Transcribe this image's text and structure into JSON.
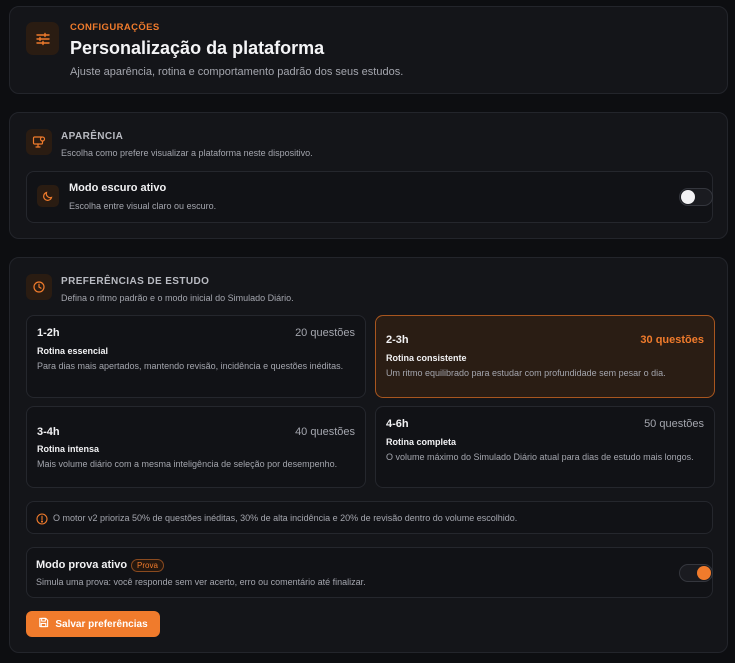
{
  "header": {
    "eyebrow": "CONFIGURAÇÕES",
    "title": "Personalização da plataforma",
    "subtitle": "Ajuste aparência, rotina e comportamento padrão dos seus estudos.",
    "icon": "sliders-icon"
  },
  "appearance": {
    "title": "APARÊNCIA",
    "description": "Escolha como prefere visualizar a plataforma neste dispositivo.",
    "icon": "monitor-settings-icon",
    "dark_mode": {
      "label": "Modo escuro ativo",
      "description": "Escolha entre visual claro ou escuro.",
      "icon": "moon-icon",
      "enabled": false
    }
  },
  "study": {
    "title": "PREFERÊNCIAS DE ESTUDO",
    "description": "Defina o ritmo padrão e o modo inicial do Simulado Diário.",
    "icon": "clock-icon",
    "options": [
      {
        "range": "1-2h",
        "count": "20 questões",
        "name": "Rotina essencial",
        "description": "Para dias mais apertados, mantendo revisão, incidência e questões inéditas.",
        "selected": false
      },
      {
        "range": "2-3h",
        "count": "30 questões",
        "name": "Rotina consistente",
        "description": "Um ritmo equilibrado para estudar com profundidade sem pesar o dia.",
        "selected": true
      },
      {
        "range": "3-4h",
        "count": "40 questões",
        "name": "Rotina intensa",
        "description": "Mais volume diário com a mesma inteligência de seleção por desempenho.",
        "selected": false
      },
      {
        "range": "4-6h",
        "count": "50 questões",
        "name": "Rotina completa",
        "description": "O volume máximo do Simulado Diário atual para dias de estudo mais longos.",
        "selected": false
      }
    ],
    "note": "O motor v2 prioriza 50% de questões inéditas, 30% de alta incidência e 20% de revisão dentro do volume escolhido.",
    "exam_mode": {
      "label": "Modo prova ativo",
      "badge": "Prova",
      "description": "Simula uma prova: você responde sem ver acerto, erro ou comentário até finalizar.",
      "enabled": true
    },
    "save_label": "Salvar preferências"
  },
  "colors": {
    "accent": "#f07b2c",
    "background": "#0d0e11",
    "card": "#141519",
    "selected_tile": "#2a1d14"
  }
}
